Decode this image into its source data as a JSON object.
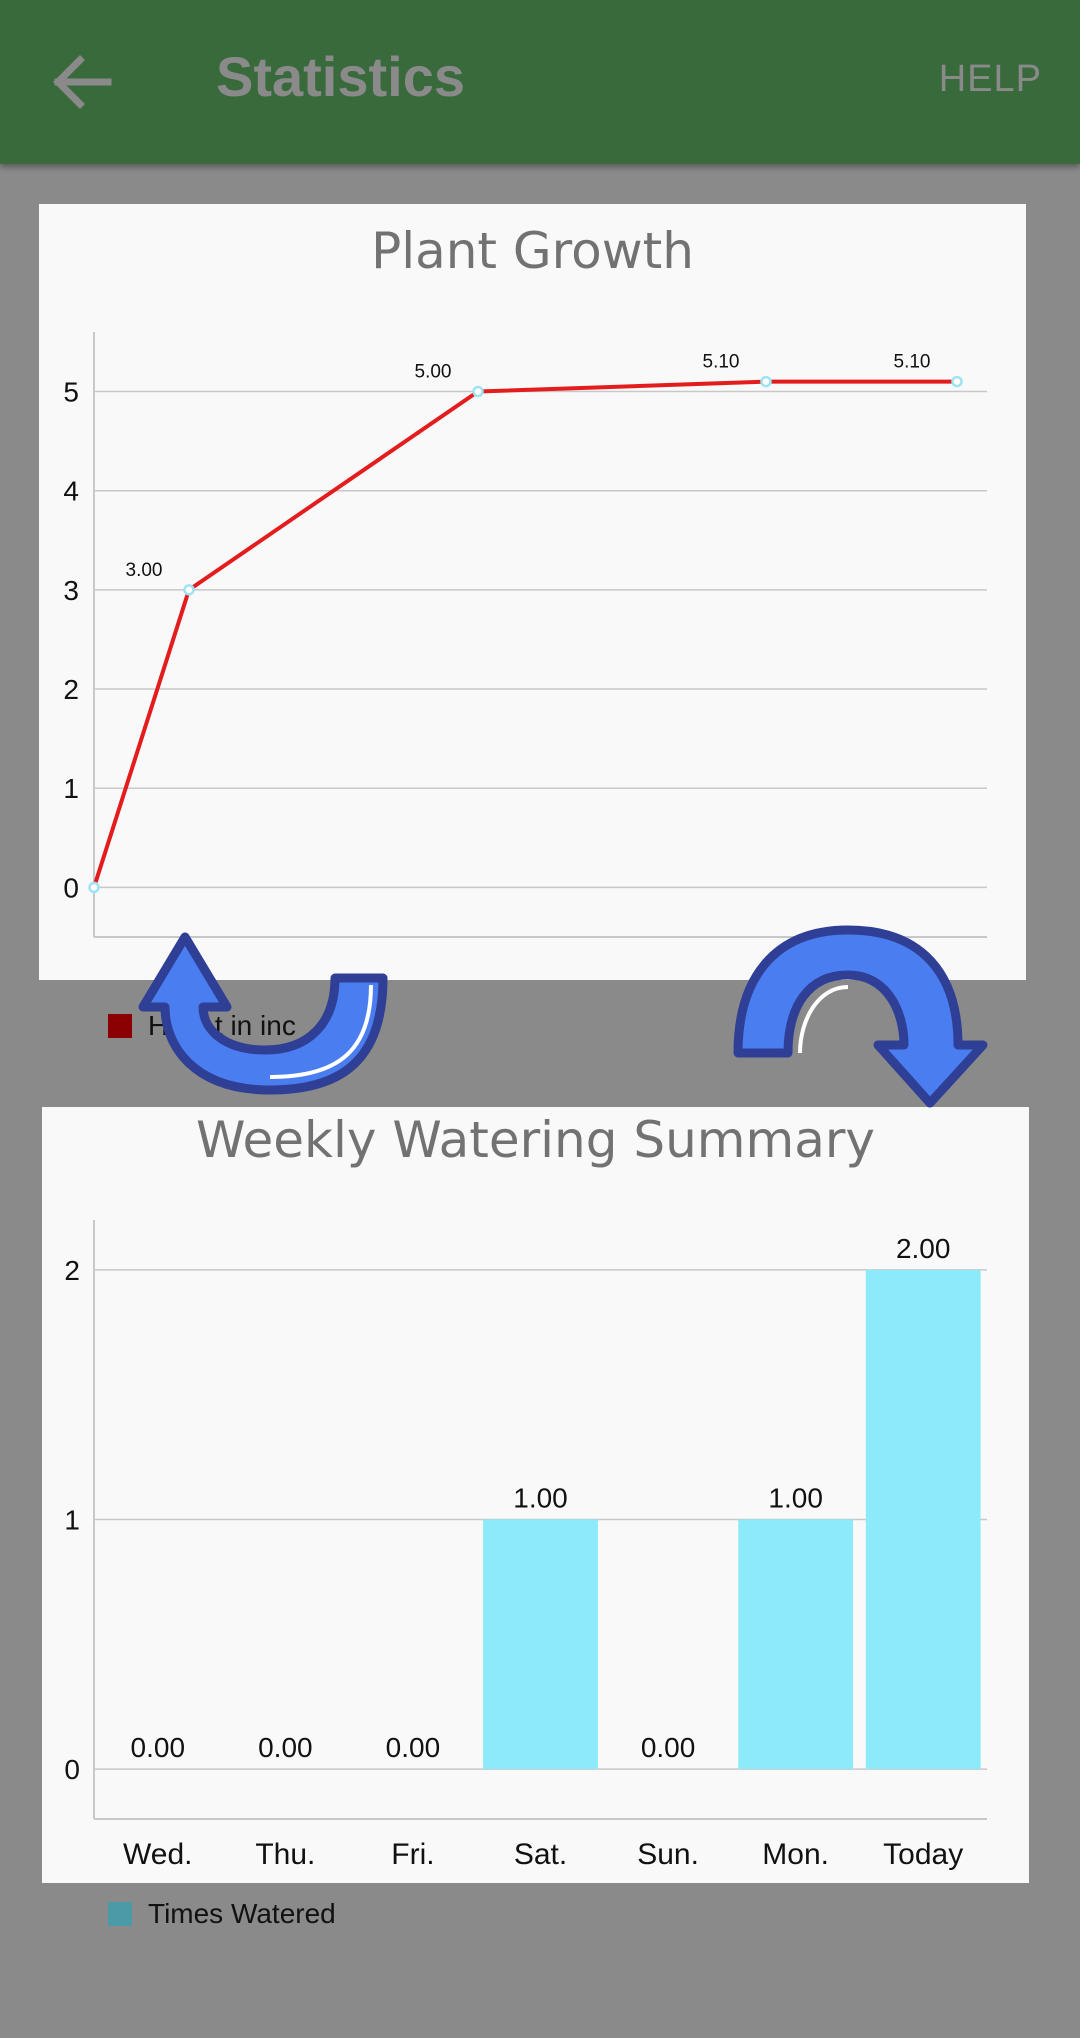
{
  "app": {
    "title": "Statistics",
    "help_label": "HELP",
    "back_icon": "arrow-left-icon",
    "colors": {
      "appbar": "#386a3c",
      "background": "#8a8a8a",
      "card": "#f9f9fa"
    }
  },
  "overlay": {
    "left_arrow_icon": "rotate-counterclockwise-icon",
    "right_arrow_icon": "rotate-clockwise-icon",
    "color": "#4a7ef0"
  },
  "chart_data": [
    {
      "type": "line",
      "title": "Plant Growth",
      "x": [
        0,
        1,
        2,
        3,
        4
      ],
      "values": [
        0,
        3.0,
        5.0,
        5.1,
        5.1
      ],
      "labels": [
        "",
        "3.00",
        "5.00",
        "5.10",
        "5.10"
      ],
      "yticks": [
        "0",
        "1",
        "2",
        "3",
        "4",
        "5"
      ],
      "ylim": [
        -0.5,
        5.6
      ],
      "grid": true,
      "legend": {
        "position": "bottom-left",
        "label": "Height in inches",
        "visible_label": "H      t in inc"
      },
      "colors": {
        "line": "#e31d1d",
        "point": "#9ee3f2",
        "legend": "#8b0000"
      }
    },
    {
      "type": "bar",
      "title": "Weekly Watering Summary",
      "categories": [
        "Wed.",
        "Thu.",
        "Fri.",
        "Sat.",
        "Sun.",
        "Mon.",
        "Today"
      ],
      "values": [
        0,
        0,
        0,
        1,
        0,
        1,
        2
      ],
      "labels": [
        "0.00",
        "0.00",
        "0.00",
        "1.00",
        "0.00",
        "1.00",
        "2.00"
      ],
      "yticks": [
        "0",
        "1",
        "2"
      ],
      "ylim": [
        -0.2,
        2.2
      ],
      "grid": true,
      "legend": {
        "position": "bottom-left",
        "label": "Times Watered"
      },
      "colors": {
        "bar": "#8deafb",
        "legend": "#4a9aa8"
      }
    }
  ]
}
